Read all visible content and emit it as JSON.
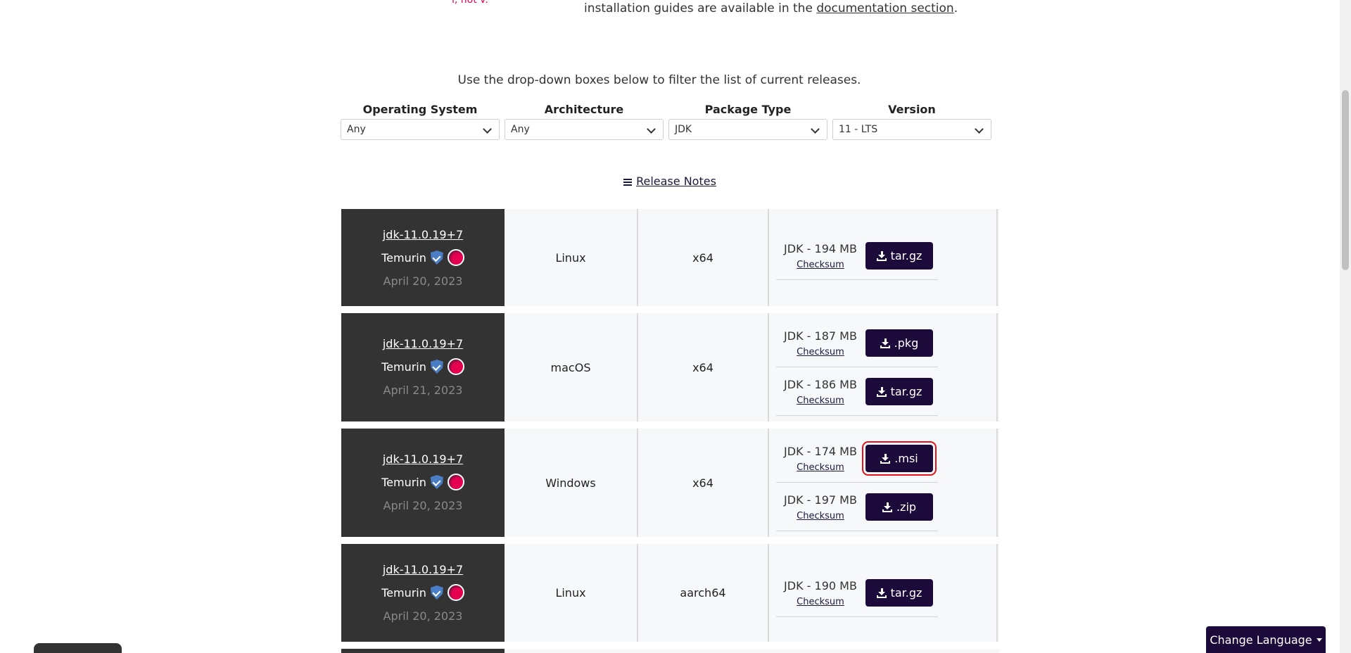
{
  "intro": {
    "fragment": "i, not v.",
    "text": "installation guides are available in the",
    "link": "documentation section",
    "period": "."
  },
  "filter_hint": "Use the drop-down boxes below to filter the list of current releases.",
  "filters": [
    {
      "label": "Operating System",
      "value": "Any"
    },
    {
      "label": "Architecture",
      "value": "Any"
    },
    {
      "label": "Package Type",
      "value": "JDK"
    },
    {
      "label": "Version",
      "value": "11 - LTS"
    }
  ],
  "release_notes": "Release Notes",
  "releases": [
    {
      "name": "jdk-11.0.19+7",
      "vendor": "Temurin",
      "date": "April 20, 2023",
      "os": "Linux",
      "arch": "x64",
      "packages": [
        {
          "size": "JDK - 194 MB",
          "checksum": "Checksum",
          "button": "tar.gz"
        }
      ]
    },
    {
      "name": "jdk-11.0.19+7",
      "vendor": "Temurin",
      "date": "April 21, 2023",
      "os": "macOS",
      "arch": "x64",
      "packages": [
        {
          "size": "JDK - 187 MB",
          "checksum": "Checksum",
          "button": ".pkg"
        },
        {
          "size": "JDK - 186 MB",
          "checksum": "Checksum",
          "button": "tar.gz"
        }
      ]
    },
    {
      "name": "jdk-11.0.19+7",
      "vendor": "Temurin",
      "date": "April 20, 2023",
      "os": "Windows",
      "arch": "x64",
      "packages": [
        {
          "size": "JDK - 174 MB",
          "checksum": "Checksum",
          "button": ".msi"
        },
        {
          "size": "JDK - 197 MB",
          "checksum": "Checksum",
          "button": ".zip"
        }
      ]
    },
    {
      "name": "jdk-11.0.19+7",
      "vendor": "Temurin",
      "date": "April 20, 2023",
      "os": "Linux",
      "arch": "aarch64",
      "packages": [
        {
          "size": "JDK - 190 MB",
          "checksum": "Checksum",
          "button": "tar.gz"
        }
      ]
    }
  ],
  "change_language": "Change Language",
  "colors": {
    "accent_dark": "#1c0b3a",
    "release_panel": "#333333",
    "highlight": "#e0141b",
    "adoptium_pink": "#e5004f"
  }
}
